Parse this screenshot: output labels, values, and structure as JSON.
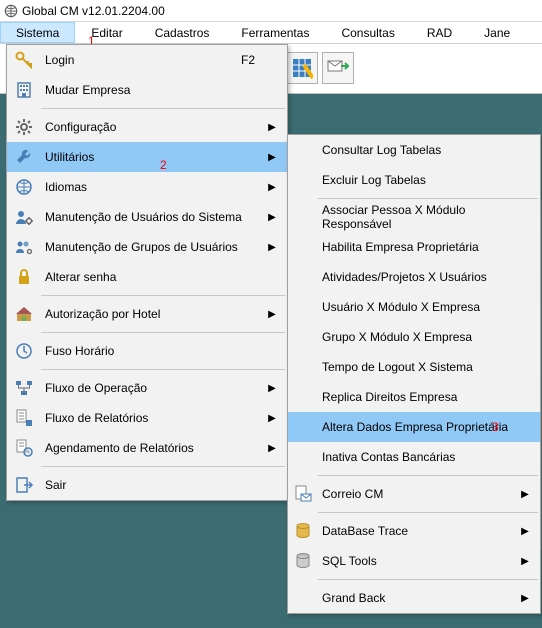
{
  "window": {
    "title": "Global CM v12.01.2204.00"
  },
  "menubar": {
    "items": [
      "Sistema",
      "Editar",
      "Cadastros",
      "Ferramentas",
      "Consultas",
      "RAD",
      "Jane"
    ],
    "active_index": 0
  },
  "annotations": {
    "one": "1",
    "two": "2",
    "three": "3"
  },
  "main_menu": {
    "items": [
      {
        "icon": "key-icon",
        "label": "Login",
        "shortcut": "F2",
        "submenu": false
      },
      {
        "icon": "building-icon",
        "label": "Mudar Empresa",
        "submenu": false
      },
      {
        "separator": true
      },
      {
        "icon": "gear-icon",
        "label": "Configuração",
        "submenu": true
      },
      {
        "icon": "wrench-icon",
        "label": "Utilitários",
        "submenu": true,
        "highlight": true
      },
      {
        "icon": "globe-icon",
        "label": "Idiomas",
        "submenu": true
      },
      {
        "icon": "users-gear-icon",
        "label": "Manutenção de Usuários do Sistema",
        "submenu": true
      },
      {
        "icon": "group-gear-icon",
        "label": "Manutenção de Grupos de Usuários",
        "submenu": true
      },
      {
        "icon": "lock-icon",
        "label": "Alterar senha",
        "submenu": false
      },
      {
        "separator": true
      },
      {
        "icon": "hotel-icon",
        "label": "Autorização por Hotel",
        "submenu": true
      },
      {
        "separator": true
      },
      {
        "icon": "clock-globe-icon",
        "label": "Fuso Horário",
        "submenu": false
      },
      {
        "separator": true
      },
      {
        "icon": "flow-icon",
        "label": "Fluxo de Operação",
        "submenu": true
      },
      {
        "icon": "report-flow-icon",
        "label": "Fluxo de Relatórios",
        "submenu": true
      },
      {
        "icon": "report-clock-icon",
        "label": "Agendamento de Relatórios",
        "submenu": true
      },
      {
        "separator": true
      },
      {
        "icon": "exit-icon",
        "label": "Sair",
        "submenu": false
      }
    ]
  },
  "sub_menu": {
    "items": [
      {
        "label": "Consultar Log Tabelas"
      },
      {
        "label": "Excluir Log Tabelas"
      },
      {
        "separator": true
      },
      {
        "label": "Associar Pessoa X Módulo Responsável"
      },
      {
        "label": "Habilita Empresa Proprietária"
      },
      {
        "label": "Atividades/Projetos X Usuários"
      },
      {
        "label": "Usuário X Módulo X Empresa"
      },
      {
        "label": "Grupo X Módulo X Empresa"
      },
      {
        "label": "Tempo de Logout X Sistema"
      },
      {
        "label": "Replica Direitos Empresa"
      },
      {
        "label": "Altera Dados Empresa Proprietária",
        "highlight": true
      },
      {
        "label": "Inativa Contas Bancárias"
      },
      {
        "separator": true
      },
      {
        "icon": "mail-doc-icon",
        "label": "Correio CM",
        "submenu": true
      },
      {
        "separator": true
      },
      {
        "icon": "db-icon",
        "label": "DataBase Trace",
        "submenu": true
      },
      {
        "icon": "sql-icon",
        "label": "SQL Tools",
        "submenu": true
      },
      {
        "separator": true
      },
      {
        "label": "Grand Back",
        "submenu": true
      }
    ]
  }
}
